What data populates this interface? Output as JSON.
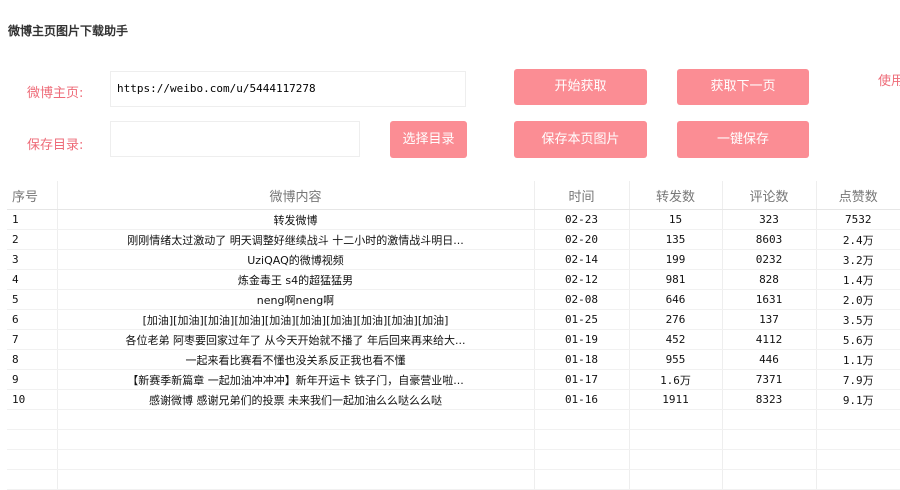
{
  "app": {
    "title": "微博主页图片下载助手"
  },
  "form": {
    "homepage_label": "微博主页:",
    "homepage_value": "https://weibo.com/u/5444117278",
    "savedir_label": "保存目录:",
    "savedir_value": ""
  },
  "buttons": {
    "start": "开始获取",
    "next_page": "获取下一页",
    "choose_dir": "选择目录",
    "save_page": "保存本页图片",
    "save_all": "一键保存"
  },
  "side_text": "使用",
  "table": {
    "headers": [
      "序号",
      "微博内容",
      "时间",
      "转发数",
      "评论数",
      "点赞数"
    ],
    "rows": [
      [
        "1",
        "转发微博",
        "02-23",
        "15",
        "323",
        "7532"
      ],
      [
        "2",
        "刚刚情绪太过激动了 明天调整好继续战斗 十二小时的激情战斗明日...",
        "02-20",
        "135",
        "8603",
        "2.4万"
      ],
      [
        "3",
        "UziQAQ的微博视频",
        "02-14",
        "199",
        "0232",
        "3.2万"
      ],
      [
        "4",
        "炼金毒王 s4的超猛猛男",
        "02-12",
        "981",
        "828",
        "1.4万"
      ],
      [
        "5",
        "neng啊neng啊",
        "02-08",
        "646",
        "1631",
        "2.0万"
      ],
      [
        "6",
        "[加油][加油][加油][加油][加油][加油][加油][加油][加油][加油]",
        "01-25",
        "276",
        "137",
        "3.5万"
      ],
      [
        "7",
        "各位老弟 阿枣要回家过年了 从今天开始就不播了 年后回来再来给大...",
        "01-19",
        "452",
        "4112",
        "5.6万"
      ],
      [
        "8",
        "一起来看比赛看不懂也没关系反正我也看不懂",
        "01-18",
        "955",
        "446",
        "1.1万"
      ],
      [
        "9",
        "【新赛季新篇章 一起加油冲冲冲】新年开运卡 铁子门，自豪营业啦...",
        "01-17",
        "1.6万",
        "7371",
        "7.9万"
      ],
      [
        "10",
        "感谢微博 感谢兄弟们的投票 未来我们一起加油么么哒么么哒",
        "01-16",
        "1911",
        "8323",
        "9.1万"
      ],
      [
        "",
        "",
        "",
        "",
        "",
        ""
      ],
      [
        "",
        "",
        "",
        "",
        "",
        ""
      ],
      [
        "",
        "",
        "",
        "",
        "",
        ""
      ],
      [
        "",
        "",
        "",
        "",
        "",
        ""
      ]
    ]
  },
  "colors": {
    "accent": "#fb8d94",
    "label": "#ee6b78"
  }
}
